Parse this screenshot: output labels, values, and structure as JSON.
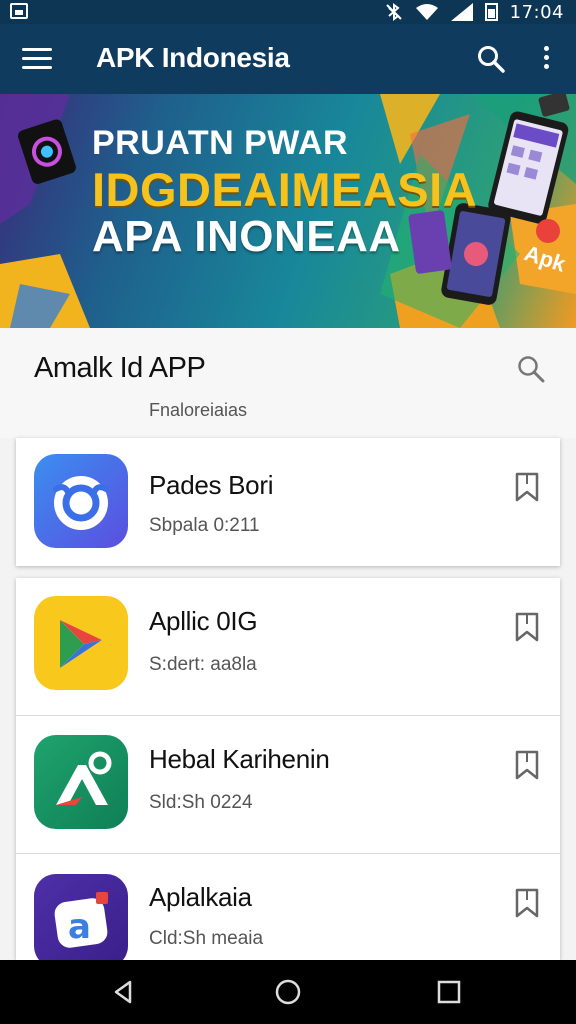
{
  "status_bar": {
    "time": "17:04"
  },
  "app_bar": {
    "title": "APK Indonesia"
  },
  "banner": {
    "line1": "PRUATN PWAR",
    "line2": "IDGDEAIMEASIA",
    "line3": "APA INONEAA",
    "sticker": "Apk"
  },
  "section": {
    "title": "Amalk Id APP",
    "subtitle": "Fnaloreiaias"
  },
  "apps": [
    {
      "name": "Pades Bori",
      "meta": "Sbpala 0:211",
      "icon": "blue-smile-icon"
    },
    {
      "name": "Apllic 0IG",
      "meta": "S:dert: aa8la",
      "icon": "play-triangle-icon"
    },
    {
      "name": "Hebal Karihenin",
      "meta": "Sld:Sh 0224",
      "icon": "green-a-icon"
    },
    {
      "name": "Aplalkaia",
      "meta": "Cld:Sh meaia",
      "icon": "purple-a-icon"
    }
  ],
  "colors": {
    "app_bar": "#0f3b5f",
    "status_bar": "#0d3554",
    "banner_yellow": "#f6c21e"
  }
}
